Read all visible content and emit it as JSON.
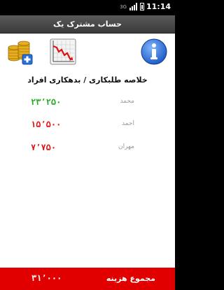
{
  "status_bar": {
    "network": "3G",
    "time": "11:14",
    "colors": {
      "background": "#000000",
      "text": "#ffffff"
    }
  },
  "title_bar": {
    "title": "حساب مشترک یک"
  },
  "toolbar": {
    "icons": [
      "add-coins-icon",
      "chart-icon",
      "info-icon"
    ]
  },
  "summary": {
    "title": "خلاصه طلبکاری / بدهکاری افراد",
    "rows": [
      {
        "name": "محمد",
        "amount": "۲۳٬۲۵۰",
        "color": "#22aa22"
      },
      {
        "name": "احمد",
        "amount": "۱۵٬۵۰۰",
        "color": "#e01010"
      },
      {
        "name": "مهران",
        "amount": "۷٬۷۵۰",
        "color": "#e01010"
      }
    ]
  },
  "footer": {
    "label": "مجموع هزینه",
    "total": "۳۱٬۰۰۰",
    "color": "#e00000"
  }
}
